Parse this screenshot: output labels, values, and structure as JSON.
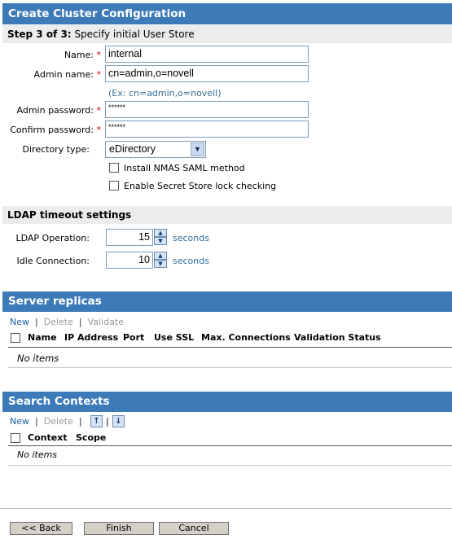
{
  "header": {
    "title": "Create Cluster Configuration"
  },
  "step": {
    "prefix": "Step 3 of 3:",
    "text": "Specify initial User Store"
  },
  "form": {
    "name_label": "Name:",
    "name_value": "internal",
    "admin_name_label": "Admin name:",
    "admin_name_value": "cn=admin,o=novell",
    "admin_name_hint": "(Ex: cn=admin,o=novell)",
    "admin_password_label": "Admin password:",
    "admin_password_value": "******",
    "confirm_password_label": "Confirm password:",
    "confirm_password_value": "******",
    "required_mark": "*",
    "directory_type_label": "Directory type:",
    "directory_type_value": "eDirectory",
    "install_nmas_label": "Install NMAS SAML method",
    "install_nmas_checked": false,
    "secret_store_label": "Enable Secret Store lock checking",
    "secret_store_checked": false
  },
  "ldap": {
    "title": "LDAP timeout settings",
    "operation_label": "LDAP Operation:",
    "operation_value": "15",
    "idle_label": "Idle Connection:",
    "idle_value": "10",
    "unit": "seconds"
  },
  "replicas": {
    "title": "Server replicas",
    "toolbar": {
      "new": "New",
      "delete": "Delete",
      "validate": "Validate",
      "sep": "|"
    },
    "columns": [
      "Name",
      "IP Address",
      "Port",
      "Use SSL",
      "Max. Connections",
      "Validation Status"
    ],
    "empty": "No items"
  },
  "contexts": {
    "title": "Search Contexts",
    "toolbar": {
      "new": "New",
      "delete": "Delete",
      "sep": "|"
    },
    "columns": [
      "Context",
      "Scope"
    ],
    "empty": "No items"
  },
  "footer": {
    "back": "<< Back",
    "finish": "Finish",
    "cancel": "Cancel"
  },
  "colors": {
    "header_bg": "#3d7ab8",
    "subheader_bg": "#ececec",
    "required": "#cc0000",
    "link": "#1d5f9f"
  }
}
